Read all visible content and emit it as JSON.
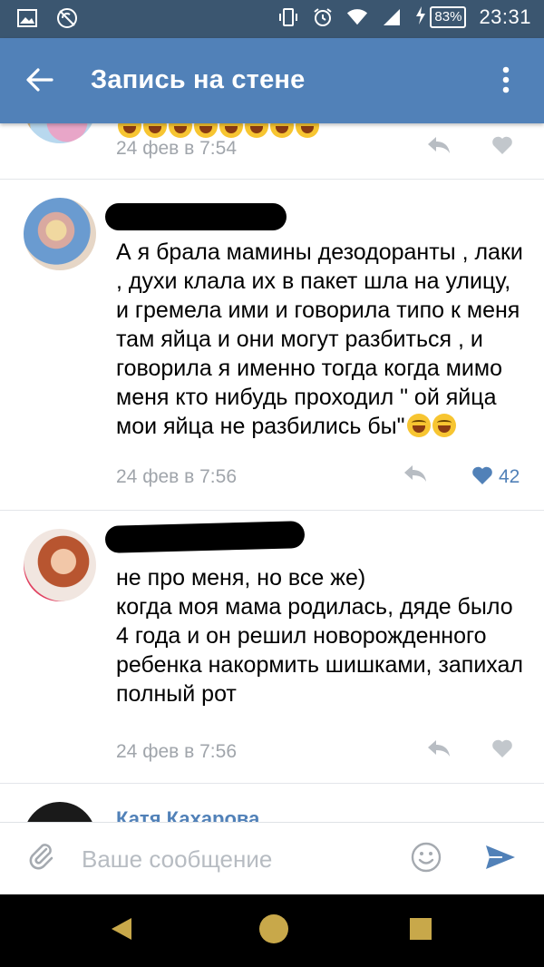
{
  "status_bar": {
    "battery": "83%",
    "time": "23:31",
    "icons": [
      "image-icon",
      "no-sync-icon",
      "vibrate-icon",
      "alarm-icon",
      "wifi-icon",
      "signal-icon",
      "charging-icon"
    ]
  },
  "toolbar": {
    "title": "Запись на стене",
    "back_icon": "arrow-left-icon",
    "menu_icon": "more-vert-icon"
  },
  "comments": [
    {
      "author": "",
      "text": "",
      "emoji_count": 8,
      "date": "24 фев в 7:54",
      "likes": "",
      "liked": false
    },
    {
      "author": "",
      "text": "А я брала мамины дезодоранты , лаки , духи клала их в пакет шла на улицу, и гремела ими и говорила типо к меня там яйца и они могут разбиться , и говорила я именно тогда когда мимо меня кто нибудь проходил \" ой яйца мои яйца не разбились бы\"",
      "emoji_count": 2,
      "date": "24 фев в 7:56",
      "likes": "42",
      "liked": true
    },
    {
      "author": "",
      "text": "не про меня, но все же)\nкогда моя мама родилась, дяде было 4 года и он решил новорожденного ребенка накормить шишками, запихал полный рот",
      "emoji_count": 0,
      "date": "24 фев в 7:56",
      "likes": "",
      "liked": false
    },
    {
      "author": "Катя Кахарова",
      "text": "",
      "emoji_count": 0,
      "date": "",
      "likes": "",
      "liked": false
    }
  ],
  "composer": {
    "placeholder": "Ваше сообщение",
    "attach_icon": "paperclip-icon",
    "emoji_icon": "smiley-icon",
    "send_icon": "send-icon"
  },
  "colors": {
    "status_bar": "#3b5670",
    "toolbar": "#5181b8",
    "link": "#5181b8",
    "meta": "#a0a5ab",
    "nav_icons": "#c8a84a"
  }
}
